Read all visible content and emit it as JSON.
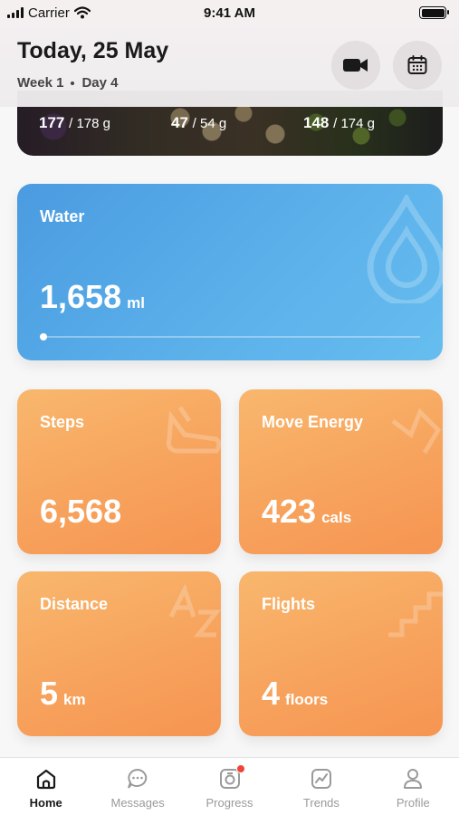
{
  "status_bar": {
    "carrier": "Carrier",
    "time": "9:41 AM"
  },
  "header": {
    "title": "Today, 25 May",
    "week": "Week 1",
    "day": "Day 4",
    "video_icon": "video-camera-icon",
    "calendar_icon": "calendar-icon"
  },
  "macros": [
    {
      "value": "177",
      "total": "/ 178 g"
    },
    {
      "value": "47",
      "total": "/ 54 g"
    },
    {
      "value": "148",
      "total": "/ 174 g"
    }
  ],
  "water": {
    "label": "Water",
    "value": "1,658",
    "unit": "ml",
    "progress": 0.01,
    "color": "#5aaee9"
  },
  "steps": {
    "label": "Steps",
    "value": "6,568",
    "unit": ""
  },
  "move_energy": {
    "label": "Move Energy",
    "value": "423",
    "unit": "cals"
  },
  "distance": {
    "label": "Distance",
    "value": "5",
    "unit": "km"
  },
  "flights": {
    "label": "Flights",
    "value": "4",
    "unit": "floors"
  },
  "tabs": [
    {
      "label": "Home",
      "icon": "home-icon",
      "active": true
    },
    {
      "label": "Messages",
      "icon": "chat-bubble-icon",
      "active": false
    },
    {
      "label": "Progress",
      "icon": "camera-progress-icon",
      "active": false,
      "badge": true
    },
    {
      "label": "Trends",
      "icon": "trend-chart-icon",
      "active": false
    },
    {
      "label": "Profile",
      "icon": "person-icon",
      "active": false
    }
  ],
  "colors": {
    "orange": "#f7a35d",
    "blue": "#5aaee9",
    "badge": "#f0433a"
  }
}
